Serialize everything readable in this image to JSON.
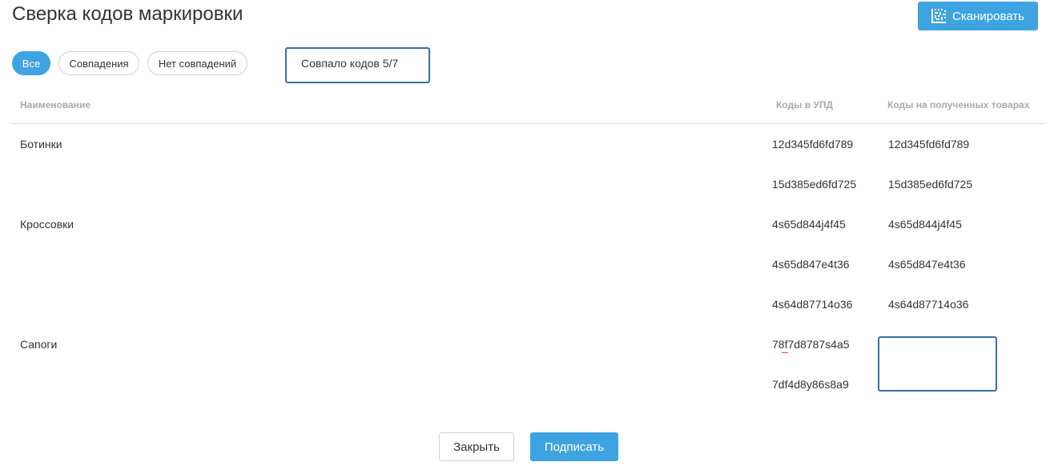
{
  "header": {
    "title": "Сверка кодов маркировки",
    "scan_label": "Сканировать"
  },
  "filters": [
    {
      "label": "Все",
      "active": true
    },
    {
      "label": "Совпадения",
      "active": false
    },
    {
      "label": "Нет совпадений",
      "active": false
    }
  ],
  "match_summary": "Совпало кодов 5/7",
  "table": {
    "columns": [
      "Наименование",
      "Коды в УПД",
      "Коды на полученных товарах"
    ],
    "rows": [
      {
        "name": "Ботинки",
        "upd_code": "12d345fd6fd789",
        "received_code": "12d345fd6fd789"
      },
      {
        "name": "",
        "upd_code": "15d385ed6fd725",
        "received_code": "15d385ed6fd725"
      },
      {
        "name": "Кроссовки",
        "upd_code": "4s65d844j4f45",
        "received_code": "4s65d844j4f45"
      },
      {
        "name": "",
        "upd_code": "4s65d847e4t36",
        "received_code": "4s65d847e4t36"
      },
      {
        "name": "",
        "upd_code": "4s64d87714o36",
        "received_code": "4s64d87714o36"
      },
      {
        "name": "Сапоги",
        "upd_code": "78f7d8787s4a5",
        "received_code": ""
      },
      {
        "name": "",
        "upd_code": "7df4d8y86s8a9",
        "received_code": ""
      }
    ]
  },
  "footer": {
    "close_label": "Закрыть",
    "sign_label": "Подписать"
  },
  "colors": {
    "accent": "#3ea3e1",
    "highlight_border": "#3b6ea5"
  }
}
